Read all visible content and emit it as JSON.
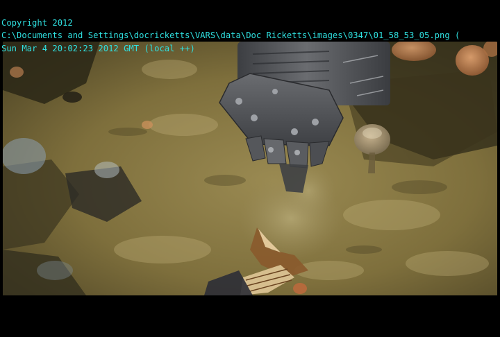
{
  "overlay": {
    "copyright": "Copyright 2012",
    "file_path": "C:\\Documents and Settings\\docricketts\\VARS\\data\\Doc Ricketts\\images\\0347\\01_58_53_05.png (",
    "timestamp": "Sun Mar 4 20:02:23 2012 GMT (local ++)",
    "text_color": "#2fe0e0"
  },
  "scene": {
    "subject": "remotely operated vehicle sampling tool pressed into seafloor sediment",
    "sediment_color": "#8a7a45",
    "tool_color": "#4a4c50",
    "letterbox_color": "#000000"
  }
}
